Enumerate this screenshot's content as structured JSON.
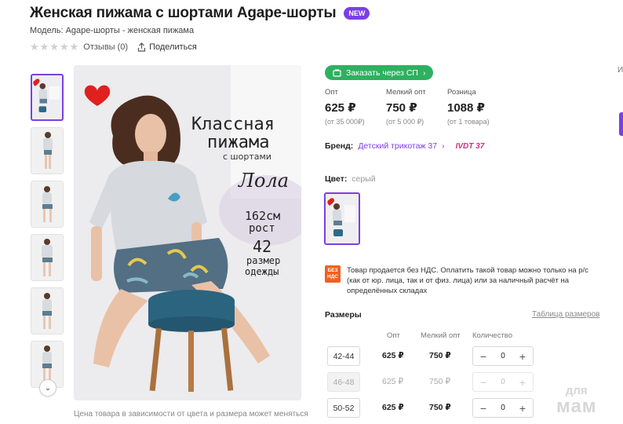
{
  "product": {
    "title": "Женская пижама с шортами Agape-шорты",
    "new_badge": "NEW",
    "model": "Модель: Agape-шорты - женская пижама",
    "reviews": "Отзывы (0)",
    "share": "Поделиться",
    "rating_stars": 0
  },
  "gallery": {
    "thumbnail_count": 6,
    "caption": "Цена товара в зависимости от цвета и размера может меняться",
    "main_image_text": {
      "line1": "Классная",
      "line2": "пижама",
      "line3": "с шортами",
      "name": "Лола",
      "height": "162см",
      "height_label": "рост",
      "size": "42",
      "size_label1": "размер",
      "size_label2": "одежды"
    }
  },
  "order": {
    "sp_button": "Заказать через СП"
  },
  "prices": [
    {
      "label": "Опт",
      "value": "625 ₽",
      "note": "(от 35 000₽)"
    },
    {
      "label": "Мелкий опт",
      "value": "750 ₽",
      "note": "(от 5 000 ₽)"
    },
    {
      "label": "Розница",
      "value": "1088 ₽",
      "note": "(от 1 товара)"
    }
  ],
  "brand": {
    "label": "Бренд:",
    "name": "Детский трикотаж 37",
    "logo_text": "IVDT 37"
  },
  "color": {
    "label": "Цвет:",
    "value": "серый"
  },
  "nds": {
    "icon_line1": "БЕЗ",
    "icon_line2": "НДС",
    "text": "Товар продается без НДС. Оплатить такой товар можно только на р/с (как от юр. лица, так и от физ. лица) или за наличный расчёт на определённых складах"
  },
  "sizes": {
    "title": "Размеры",
    "table_link": "Таблица размеров",
    "headers": {
      "opt": "Опт",
      "small_opt": "Мелкий опт",
      "qty": "Количество"
    },
    "rows": [
      {
        "size": "42-44",
        "opt": "625 ₽",
        "small_opt": "750 ₽",
        "qty": "0",
        "available": true
      },
      {
        "size": "46-48",
        "opt": "625 ₽",
        "small_opt": "750 ₽",
        "qty": "0",
        "available": false
      },
      {
        "size": "50-52",
        "opt": "625 ₽",
        "small_opt": "750 ₽",
        "qty": "0",
        "available": true
      }
    ]
  },
  "side": {
    "letter": "И"
  },
  "watermark": {
    "line1": "для",
    "line2": "мам"
  },
  "colors": {
    "accent": "#7b3fe4",
    "sp_green": "#2fb061",
    "nds_orange": "#f25f1e",
    "heart": "#e0201f"
  }
}
